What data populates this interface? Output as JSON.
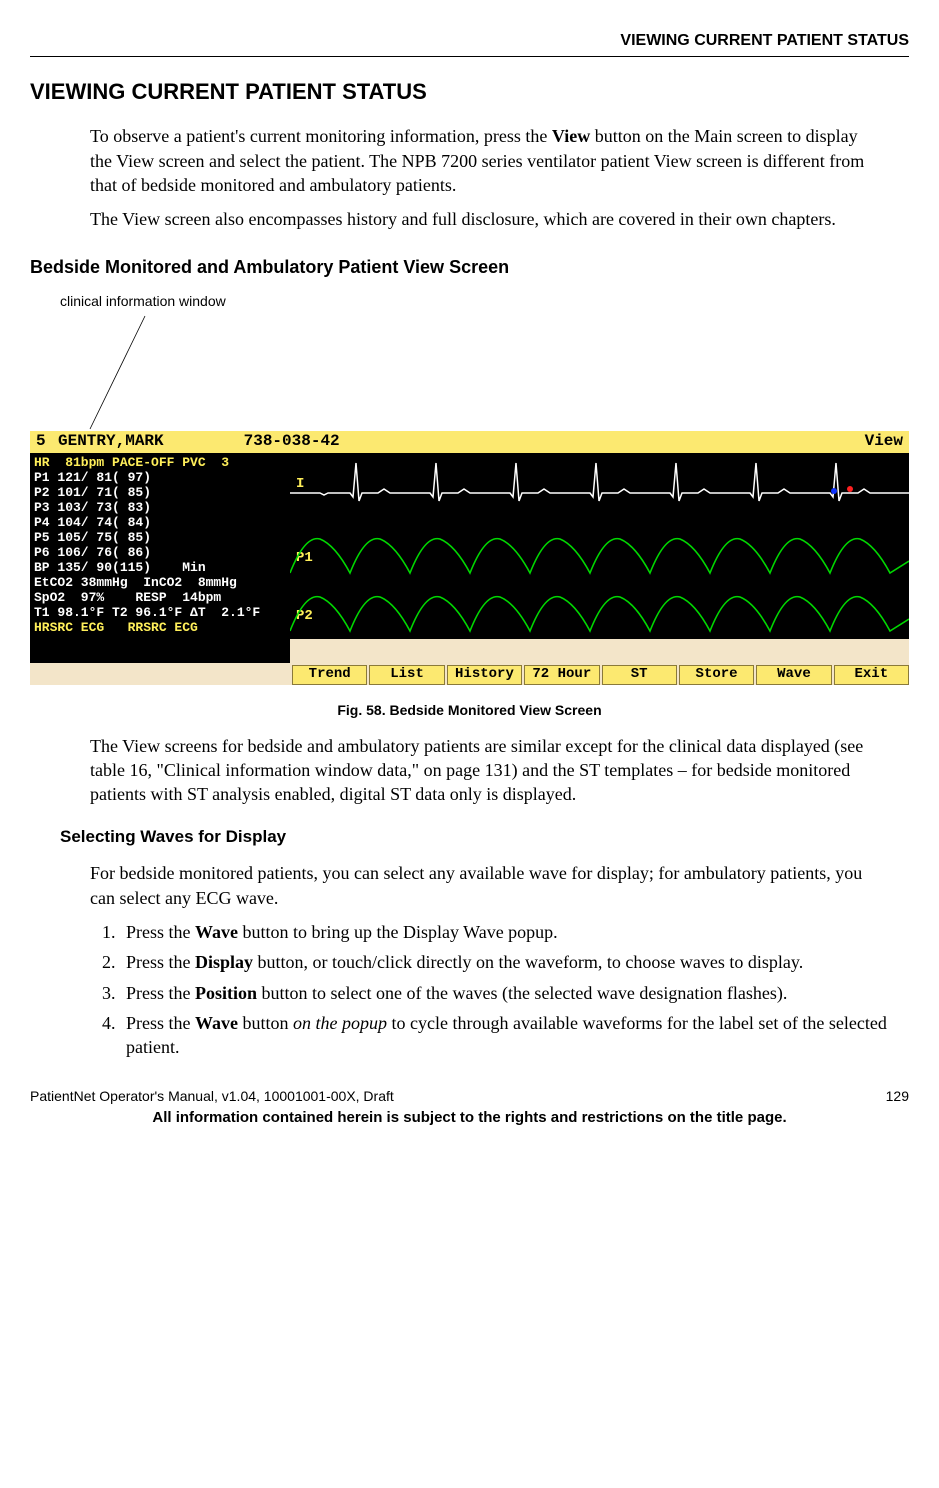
{
  "running_header": "VIEWING CURRENT PATIENT STATUS",
  "section_title": "VIEWING CURRENT PATIENT STATUS",
  "intro_p1_a": "To observe a patient's current monitoring information, press the ",
  "intro_p1_bold": "View",
  "intro_p1_b": " button on the Main screen to display the View screen and select the patient. The NPB 7200 series ventilator patient View screen is different from that of bedside monitored and ambulatory patients.",
  "intro_p2": "The View screen also encompasses history and full disclosure, which are covered in their own chapters.",
  "subsection_title": "Bedside Monitored and Ambulatory Patient View Screen",
  "callout_label": "clinical information window",
  "screen": {
    "bed": "5",
    "patient": "GENTRY,MARK",
    "id": "738-038-42",
    "mode": "View",
    "clin_lines": [
      "HR  81bpm PACE-OFF PVC  3",
      "P1 121/ 81( 97)",
      "P2 101/ 71( 85)",
      "P3 103/ 73( 83)",
      "P4 104/ 74( 84)",
      "P5 105/ 75( 85)",
      "P6 106/ 76( 86)",
      "BP 135/ 90(115)    Min",
      "EtCO2 38mmHg  InCO2  8mmHg",
      "SpO2  97%    RESP  14bpm",
      "T1 98.1°F T2 96.1°F ΔT  2.1°F",
      "HRSRC ECG   RRSRC ECG"
    ],
    "wave_labels": {
      "p1": "P1",
      "p2": "P2"
    },
    "buttons": [
      "Trend",
      "List",
      "History",
      "72 Hour",
      "ST",
      "Store",
      "Wave",
      "Exit"
    ]
  },
  "fig_caption": "Fig. 58. Bedside Monitored View Screen",
  "after_fig_p": "The View screens for bedside and ambulatory patients are similar except for the clinical data displayed (see table 16, \"Clinical information window data,\" on page 131) and the ST templates – for bedside monitored patients with ST analysis enabled, digital ST data only is displayed.",
  "subsub_title": "Selecting Waves for Display",
  "sel_p": "For bedside monitored patients, you can select any available wave for display; for ambulatory patients, you can select any ECG wave.",
  "steps": {
    "s1a": "Press the ",
    "s1b": "Wave",
    "s1c": " button to bring up the Display Wave popup.",
    "s2a": "Press the ",
    "s2b": "Display",
    "s2c": " button, or touch/click directly on the waveform, to choose waves to display.",
    "s3a": "Press the ",
    "s3b": "Position",
    "s3c": " button to select one of the waves (the selected wave designation flashes).",
    "s4a": "Press the ",
    "s4b": "Wave",
    "s4c": " button ",
    "s4d": "on the popup",
    "s4e": " to cycle through available waveforms for the label set of the selected patient."
  },
  "footer": {
    "left": "PatientNet Operator's Manual, v1.04, 10001001-00X, Draft",
    "right": "129",
    "bold": "All information contained herein is subject to the rights and restrictions on the title page."
  }
}
